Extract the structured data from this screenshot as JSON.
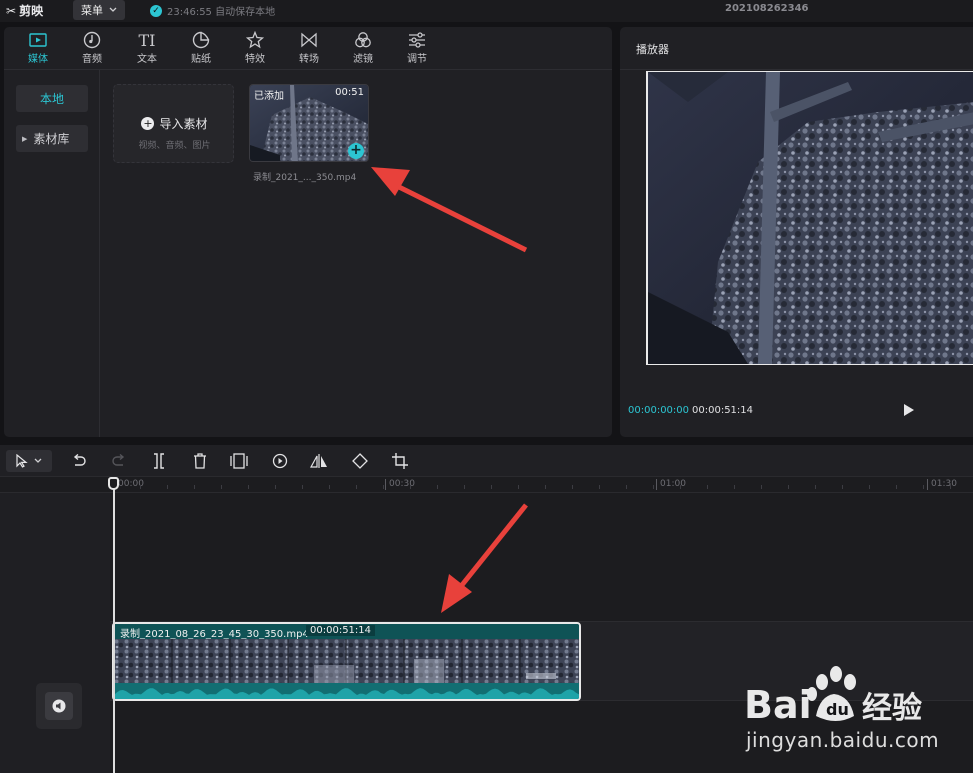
{
  "app": {
    "logo_text": "剪映",
    "menu_label": "菜单",
    "save_status": "23:46:55 自动保存本地",
    "project_name": "202108262346"
  },
  "media_panel": {
    "tabs": [
      {
        "label": "媒体",
        "icon": "media-icon",
        "active": true
      },
      {
        "label": "音频",
        "icon": "audio-icon",
        "active": false
      },
      {
        "label": "文本",
        "icon": "text-icon",
        "active": false
      },
      {
        "label": "贴纸",
        "icon": "sticker-icon",
        "active": false
      },
      {
        "label": "特效",
        "icon": "effects-icon",
        "active": false
      },
      {
        "label": "转场",
        "icon": "transition-icon",
        "active": false
      },
      {
        "label": "滤镜",
        "icon": "filter-icon",
        "active": false
      },
      {
        "label": "调节",
        "icon": "adjust-icon",
        "active": false
      }
    ],
    "side_nav": {
      "local": "本地",
      "library": "素材库"
    },
    "import": {
      "label": "导入素材",
      "hint": "视频、音频、图片"
    },
    "item": {
      "status": "已添加",
      "duration": "00:51",
      "filename": "录制_2021_..._350.mp4"
    }
  },
  "player": {
    "title": "播放器",
    "current_time": "00:00:00:00",
    "total_time": "00:00:51:14"
  },
  "timeline": {
    "ruler": [
      "00:00",
      "00:30",
      "01:00",
      "01:30"
    ],
    "clip": {
      "name": "录制_2021_08_26_23_45_30_350.mp4",
      "duration": "00:00:51:14"
    }
  },
  "watermark": {
    "brand": "Baidu经验",
    "url": "jingyan.baidu.com"
  },
  "colors": {
    "accent": "#2cc5d2",
    "clip": "#0f5356",
    "annotation_arrow": "#e8413b"
  }
}
